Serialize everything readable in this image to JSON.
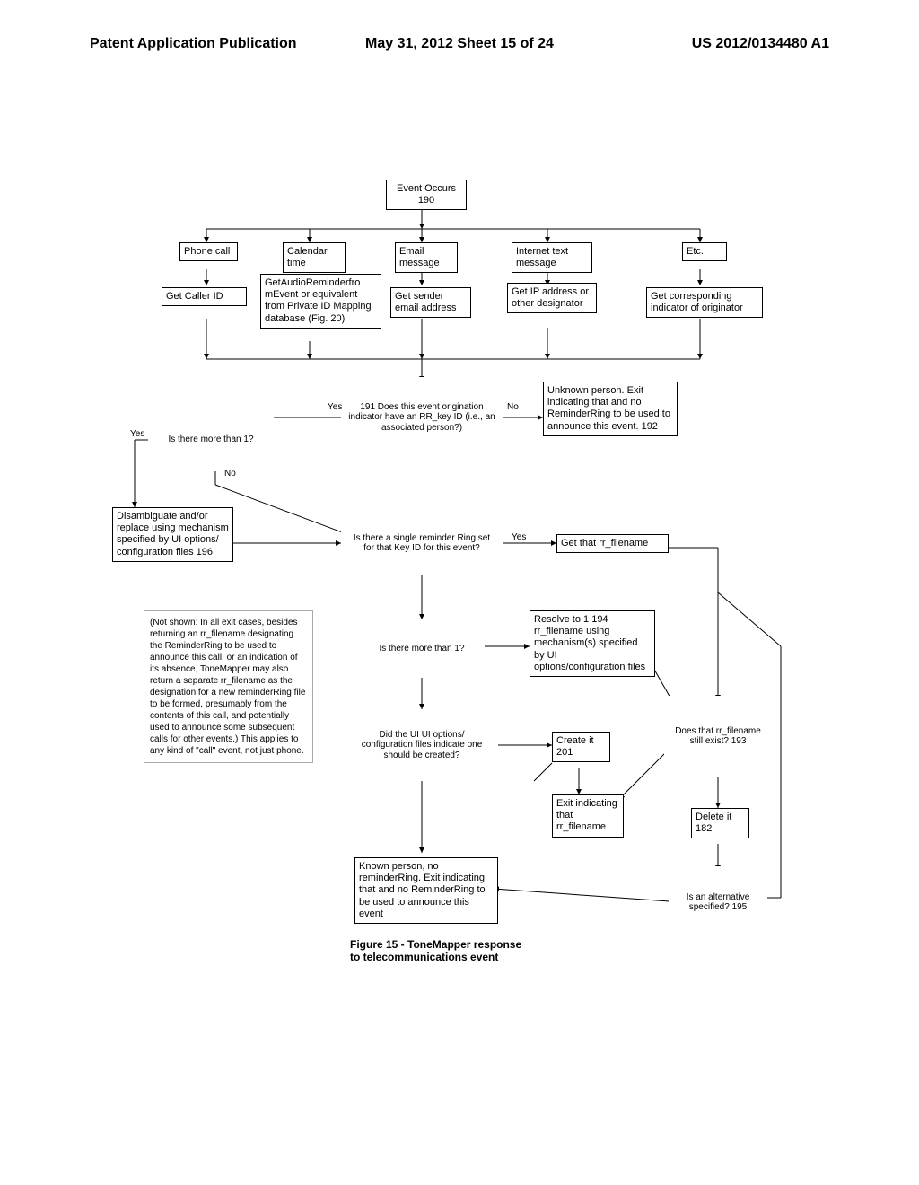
{
  "header": {
    "left": "Patent Application Publication",
    "center": "May 31, 2012  Sheet 15 of 24",
    "right": "US 2012/0134480 A1"
  },
  "box_event": "Event Occurs\n190",
  "type_phone": "Phone\ncall",
  "type_calendar": "Calendar\ntime",
  "type_email": "Email\nmessage",
  "type_internet": "Internet\ntext message",
  "type_etc": "Etc.",
  "get_caller": "Get Caller ID",
  "get_calendar": "GetAudioReminderfro\nmEvent or equivalent\nfrom Private ID\nMapping database\n(Fig. 20)",
  "get_email": "Get sender\nemail address",
  "get_ip": "Get IP address\nor other\ndesignator",
  "get_etc": "Get corresponding\nindicator of originator",
  "d191": "191\nDoes this event\norigination indicator have an\nRR_key ID (i.e., an associated\nperson?)",
  "box192": "Unknown person. Exit\nindicating that and no\nReminderRing to be used\nto announce this event.\n192",
  "d_more1": "Is there more than 1?",
  "box196": "Disambiguate and/or\nreplace using\nmechanism specified\nby UI options/\nconfiguration files 196",
  "d_single": "Is there a single reminder\nRing set for that Key ID for\nthis event?",
  "box_getfn": "Get that rr_filename",
  "d_more2": "Is there more than 1?",
  "box194": "Resolve to 1       194\nrr_filename using\nmechanism(s)\nspecified by UI\noptions/configuration\nfiles",
  "d_ui": "Did the UI UI options/\nconfiguration files indicate\none should be created?",
  "box201": "Create\nit    201",
  "d193": "Does that\nrr_filename\nstill exist?\n193",
  "box_known": "Known person, no\nreminderRing. Exit\nindicating that and no\nReminderRing to be used\nto announce this event",
  "box_exit": "Exit\nindicating\nthat\nrr_filename",
  "box_delete": "Delete\nit    182",
  "d195": "Is an\nalternative\nspecified?\n195",
  "note_text": "(Not shown: In all exit cases, besides returning an rr_filename designating the ReminderRing to be used to announce this call, or an indication of its absence, ToneMapper may also return a separate rr_filename as the designation for a new reminderRing file to be formed, presumably from the contents of this call, and potentially used to announce some subsequent calls for other events.)\n\nThis applies to any kind of \"call\" event, not just phone.",
  "caption": "Figure 15 - ToneMapper response\nto telecommunications event",
  "yes": "Yes",
  "no": "No"
}
